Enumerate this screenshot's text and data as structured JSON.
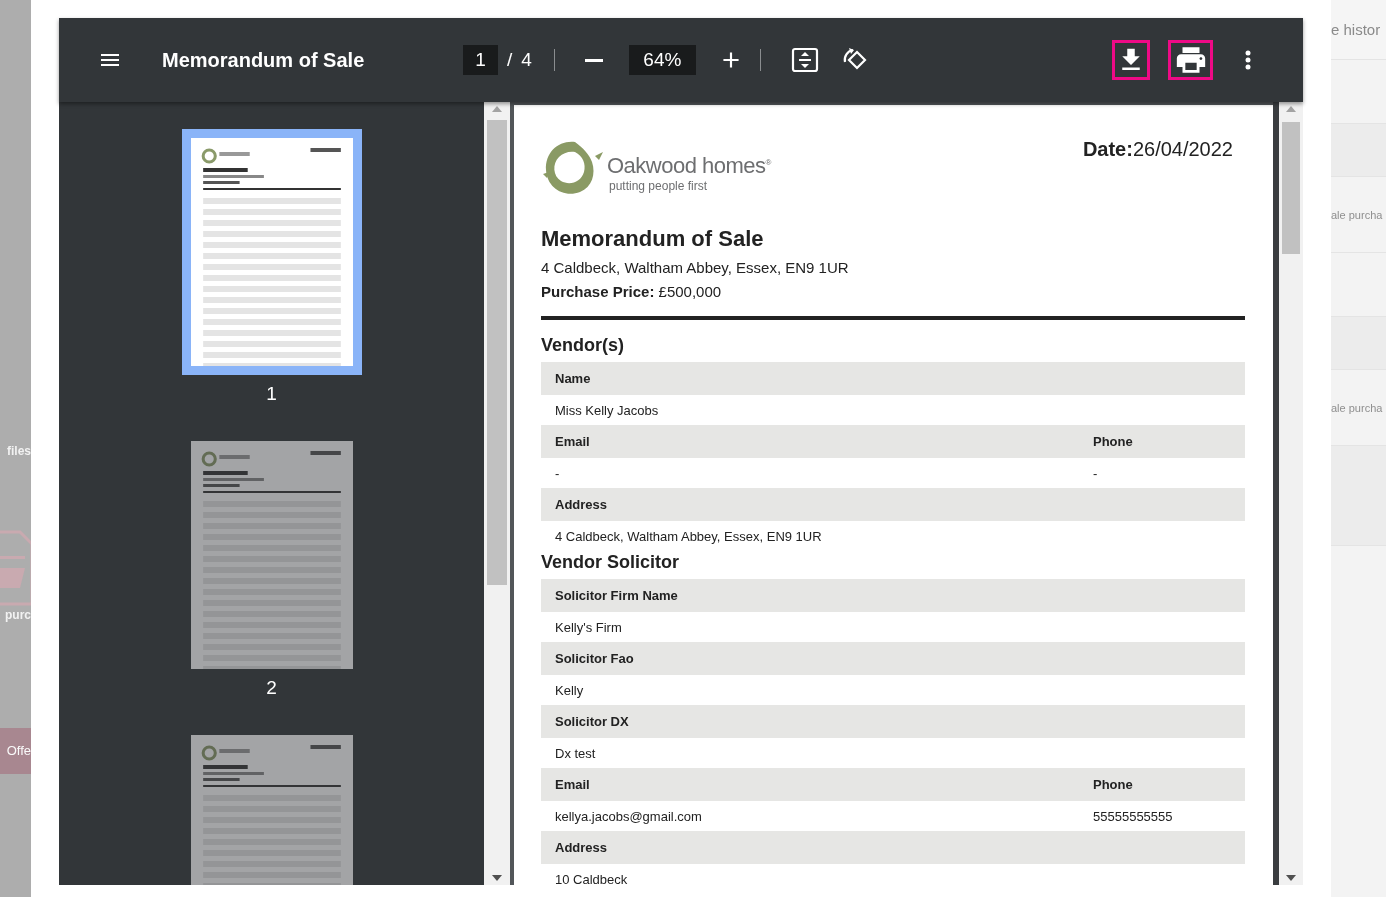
{
  "background": {
    "left": [
      {
        "kind": "text",
        "text": "files"
      },
      {
        "kind": "file-icon"
      },
      {
        "kind": "text",
        "text": "purc"
      },
      {
        "kind": "button",
        "text": "Offe"
      }
    ],
    "right": [
      {
        "text": "e histor"
      },
      {
        "text": "ale purcha"
      },
      {
        "text": "ale purcha"
      }
    ]
  },
  "toolbar": {
    "title": "Memorandum of Sale",
    "page": "1",
    "separator": "/",
    "page_count": "4",
    "zoom": "64%",
    "buttons": [
      {
        "kind": "zoom-out",
        "highlighted": false
      },
      {
        "kind": "zoom-in",
        "highlighted": false
      },
      {
        "kind": "fit",
        "highlighted": false
      },
      {
        "kind": "rotate",
        "highlighted": false
      },
      {
        "kind": "download",
        "highlighted": true
      },
      {
        "kind": "print",
        "highlighted": true
      },
      {
        "kind": "more",
        "highlighted": false
      }
    ]
  },
  "thumbnails": [
    {
      "label": "1",
      "selected": true
    },
    {
      "label": "2",
      "selected": false
    },
    {
      "selected": false
    }
  ],
  "document": {
    "logo": {
      "name": "Oakwood homes$^{®}$",
      "tagline": "putting people first"
    },
    "date_label": "Date:",
    "date": "26/04/2022",
    "title": "Memorandum of Sale",
    "address": "4 Caldbeck, Waltham Abbey, Essex, EN9 1UR",
    "price_label": "Purchase Price:",
    "price": "£500,000",
    "sections": [
      {
        "title": "Vendor(s)",
        "rows": [
          {
            "kind": "header",
            "cells": [
              "Name"
            ]
          },
          {
            "kind": "value",
            "cells": [
              "Miss Kelly Jacobs"
            ]
          },
          {
            "kind": "header",
            "cells": [
              "Email",
              "Phone"
            ]
          },
          {
            "kind": "value",
            "cells": [
              "-",
              "-"
            ]
          },
          {
            "kind": "header",
            "cells": [
              "Address"
            ]
          },
          {
            "kind": "value",
            "cells": [
              "4 Caldbeck, Waltham Abbey, Essex, EN9 1UR"
            ]
          }
        ]
      },
      {
        "title": "Vendor Solicitor",
        "rows": [
          {
            "kind": "header",
            "cells": [
              "Solicitor Firm Name"
            ]
          },
          {
            "kind": "value",
            "cells": [
              "Kelly's Firm"
            ]
          },
          {
            "kind": "header",
            "cells": [
              "Solicitor Fao"
            ]
          },
          {
            "kind": "value",
            "cells": [
              "Kelly"
            ]
          },
          {
            "kind": "header",
            "cells": [
              "Solicitor DX"
            ]
          },
          {
            "kind": "value",
            "cells": [
              "Dx test"
            ]
          },
          {
            "kind": "header",
            "cells": [
              "Email",
              "Phone"
            ]
          },
          {
            "kind": "value",
            "cells": [
              "kellya.jacobs@gmail.com",
              "55555555555"
            ]
          },
          {
            "kind": "header",
            "cells": [
              "Address"
            ]
          },
          {
            "kind": "value",
            "cells": [
              "10 Caldbeck"
            ]
          }
        ]
      }
    ]
  }
}
